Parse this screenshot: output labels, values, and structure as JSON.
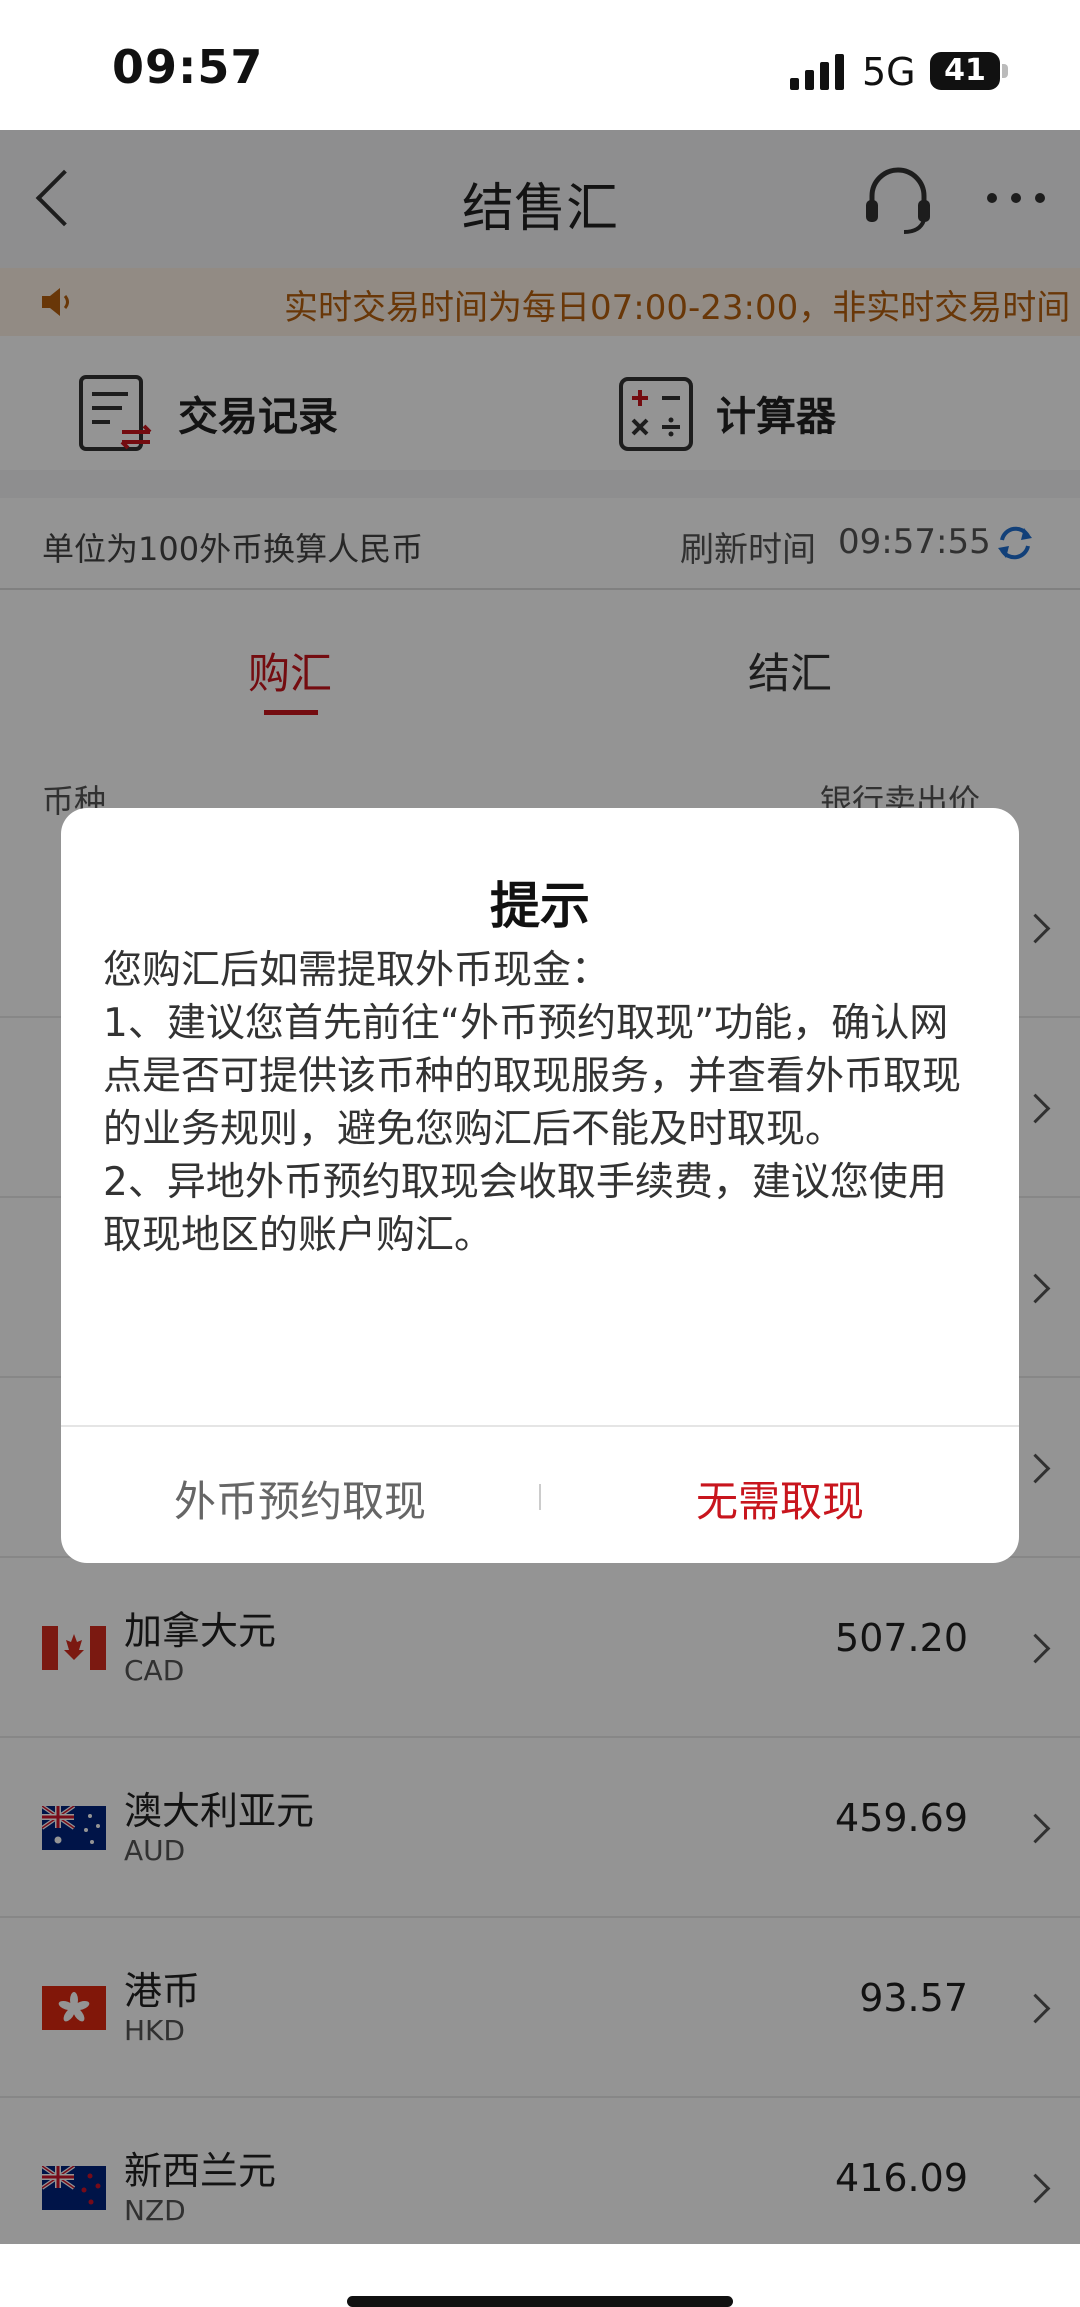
{
  "status_bar": {
    "time": "09:57",
    "network": "5G",
    "battery": "41"
  },
  "navbar": {
    "title": "结售汇"
  },
  "notice": {
    "text": "实时交易时间为每日07:00-23:00，非实时交易时间"
  },
  "tools": {
    "records_label": "交易记录",
    "calculator_label": "计算器"
  },
  "unit_bar": {
    "unit_text": "单位为100外币换算人民币",
    "refresh_label": "刷新时间",
    "refresh_time": "09:57:55"
  },
  "tabs": [
    {
      "label": "购汇",
      "active": true
    },
    {
      "label": "结汇",
      "active": false
    }
  ],
  "list_header": {
    "currency_col": "币种",
    "price_col": "银行卖出价"
  },
  "currencies": [
    {
      "name": "加拿大元",
      "code": "CAD",
      "price": "507.20",
      "flag": "canada-flag"
    },
    {
      "name": "澳大利亚元",
      "code": "AUD",
      "price": "459.69",
      "flag": "australia-flag"
    },
    {
      "name": "港币",
      "code": "HKD",
      "price": "93.57",
      "flag": "hong-kong-flag"
    },
    {
      "name": "新西兰元",
      "code": "NZD",
      "price": "416.09",
      "flag": "new-zealand-flag"
    }
  ],
  "dialog": {
    "title": "提示",
    "body": "您购汇后如需提取外币现金：\n1、建议您首先前往“外币预约取现”功能，确认网点是否可提供该币种的取现服务，并查看外币取现的业务规则，避免您购汇后不能及时取现。\n2、异地外币预约取现会收取手续费，建议您使用取现地区的账户购汇。",
    "secondary_button": "外币预约取现",
    "primary_button": "无需取现"
  },
  "colors": {
    "accent_red": "#c8151d",
    "notice_text": "#b5600e",
    "notice_bg": "#fbf0e3",
    "refresh_blue": "#1f6fd1"
  }
}
